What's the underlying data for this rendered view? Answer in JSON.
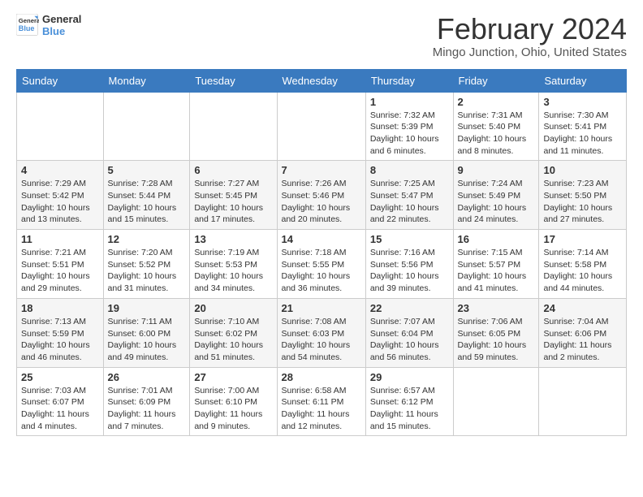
{
  "header": {
    "logo_line1": "General",
    "logo_line2": "Blue",
    "title": "February 2024",
    "subtitle": "Mingo Junction, Ohio, United States"
  },
  "days_of_week": [
    "Sunday",
    "Monday",
    "Tuesday",
    "Wednesday",
    "Thursday",
    "Friday",
    "Saturday"
  ],
  "weeks": [
    [
      {
        "day": "",
        "info": ""
      },
      {
        "day": "",
        "info": ""
      },
      {
        "day": "",
        "info": ""
      },
      {
        "day": "",
        "info": ""
      },
      {
        "day": "1",
        "info": "Sunrise: 7:32 AM\nSunset: 5:39 PM\nDaylight: 10 hours and 6 minutes."
      },
      {
        "day": "2",
        "info": "Sunrise: 7:31 AM\nSunset: 5:40 PM\nDaylight: 10 hours and 8 minutes."
      },
      {
        "day": "3",
        "info": "Sunrise: 7:30 AM\nSunset: 5:41 PM\nDaylight: 10 hours and 11 minutes."
      }
    ],
    [
      {
        "day": "4",
        "info": "Sunrise: 7:29 AM\nSunset: 5:42 PM\nDaylight: 10 hours and 13 minutes."
      },
      {
        "day": "5",
        "info": "Sunrise: 7:28 AM\nSunset: 5:44 PM\nDaylight: 10 hours and 15 minutes."
      },
      {
        "day": "6",
        "info": "Sunrise: 7:27 AM\nSunset: 5:45 PM\nDaylight: 10 hours and 17 minutes."
      },
      {
        "day": "7",
        "info": "Sunrise: 7:26 AM\nSunset: 5:46 PM\nDaylight: 10 hours and 20 minutes."
      },
      {
        "day": "8",
        "info": "Sunrise: 7:25 AM\nSunset: 5:47 PM\nDaylight: 10 hours and 22 minutes."
      },
      {
        "day": "9",
        "info": "Sunrise: 7:24 AM\nSunset: 5:49 PM\nDaylight: 10 hours and 24 minutes."
      },
      {
        "day": "10",
        "info": "Sunrise: 7:23 AM\nSunset: 5:50 PM\nDaylight: 10 hours and 27 minutes."
      }
    ],
    [
      {
        "day": "11",
        "info": "Sunrise: 7:21 AM\nSunset: 5:51 PM\nDaylight: 10 hours and 29 minutes."
      },
      {
        "day": "12",
        "info": "Sunrise: 7:20 AM\nSunset: 5:52 PM\nDaylight: 10 hours and 31 minutes."
      },
      {
        "day": "13",
        "info": "Sunrise: 7:19 AM\nSunset: 5:53 PM\nDaylight: 10 hours and 34 minutes."
      },
      {
        "day": "14",
        "info": "Sunrise: 7:18 AM\nSunset: 5:55 PM\nDaylight: 10 hours and 36 minutes."
      },
      {
        "day": "15",
        "info": "Sunrise: 7:16 AM\nSunset: 5:56 PM\nDaylight: 10 hours and 39 minutes."
      },
      {
        "day": "16",
        "info": "Sunrise: 7:15 AM\nSunset: 5:57 PM\nDaylight: 10 hours and 41 minutes."
      },
      {
        "day": "17",
        "info": "Sunrise: 7:14 AM\nSunset: 5:58 PM\nDaylight: 10 hours and 44 minutes."
      }
    ],
    [
      {
        "day": "18",
        "info": "Sunrise: 7:13 AM\nSunset: 5:59 PM\nDaylight: 10 hours and 46 minutes."
      },
      {
        "day": "19",
        "info": "Sunrise: 7:11 AM\nSunset: 6:00 PM\nDaylight: 10 hours and 49 minutes."
      },
      {
        "day": "20",
        "info": "Sunrise: 7:10 AM\nSunset: 6:02 PM\nDaylight: 10 hours and 51 minutes."
      },
      {
        "day": "21",
        "info": "Sunrise: 7:08 AM\nSunset: 6:03 PM\nDaylight: 10 hours and 54 minutes."
      },
      {
        "day": "22",
        "info": "Sunrise: 7:07 AM\nSunset: 6:04 PM\nDaylight: 10 hours and 56 minutes."
      },
      {
        "day": "23",
        "info": "Sunrise: 7:06 AM\nSunset: 6:05 PM\nDaylight: 10 hours and 59 minutes."
      },
      {
        "day": "24",
        "info": "Sunrise: 7:04 AM\nSunset: 6:06 PM\nDaylight: 11 hours and 2 minutes."
      }
    ],
    [
      {
        "day": "25",
        "info": "Sunrise: 7:03 AM\nSunset: 6:07 PM\nDaylight: 11 hours and 4 minutes."
      },
      {
        "day": "26",
        "info": "Sunrise: 7:01 AM\nSunset: 6:09 PM\nDaylight: 11 hours and 7 minutes."
      },
      {
        "day": "27",
        "info": "Sunrise: 7:00 AM\nSunset: 6:10 PM\nDaylight: 11 hours and 9 minutes."
      },
      {
        "day": "28",
        "info": "Sunrise: 6:58 AM\nSunset: 6:11 PM\nDaylight: 11 hours and 12 minutes."
      },
      {
        "day": "29",
        "info": "Sunrise: 6:57 AM\nSunset: 6:12 PM\nDaylight: 11 hours and 15 minutes."
      },
      {
        "day": "",
        "info": ""
      },
      {
        "day": "",
        "info": ""
      }
    ]
  ]
}
